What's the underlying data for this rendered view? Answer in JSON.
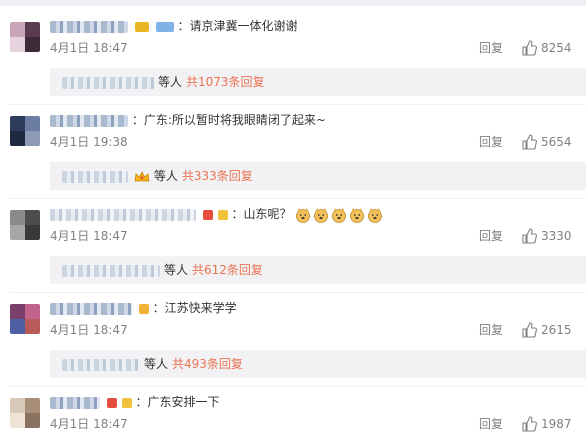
{
  "comments": [
    {
      "text": "：请京津冀一体化谢谢",
      "date": "4月1日 18:47",
      "reply_label": "回复",
      "likes": "8254",
      "thread": {
        "who": "等人",
        "more": "共1073条回复"
      }
    },
    {
      "text": "：广东:所以暂时将我眼睛闭了起来~",
      "date": "4月1日 19:38",
      "reply_label": "回复",
      "likes": "5654",
      "thread": {
        "who": "等人",
        "more": "共333条回复"
      }
    },
    {
      "text": "：山东呢？",
      "date": "4月1日 18:47",
      "reply_label": "回复",
      "likes": "3330",
      "thread": {
        "who": "等人",
        "more": "共612条回复"
      }
    },
    {
      "text": "：江苏快来学学",
      "date": "4月1日 18:47",
      "reply_label": "回复",
      "likes": "2615",
      "thread": {
        "who": "等人",
        "more": "共493条回复"
      }
    },
    {
      "text": "：广东安排一下",
      "date": "4月1日 18:47",
      "reply_label": "回复",
      "likes": "1987"
    }
  ],
  "colors": {
    "link": "#eb7350",
    "meta": "#808080",
    "reply_bg": "#f2f2f5"
  }
}
